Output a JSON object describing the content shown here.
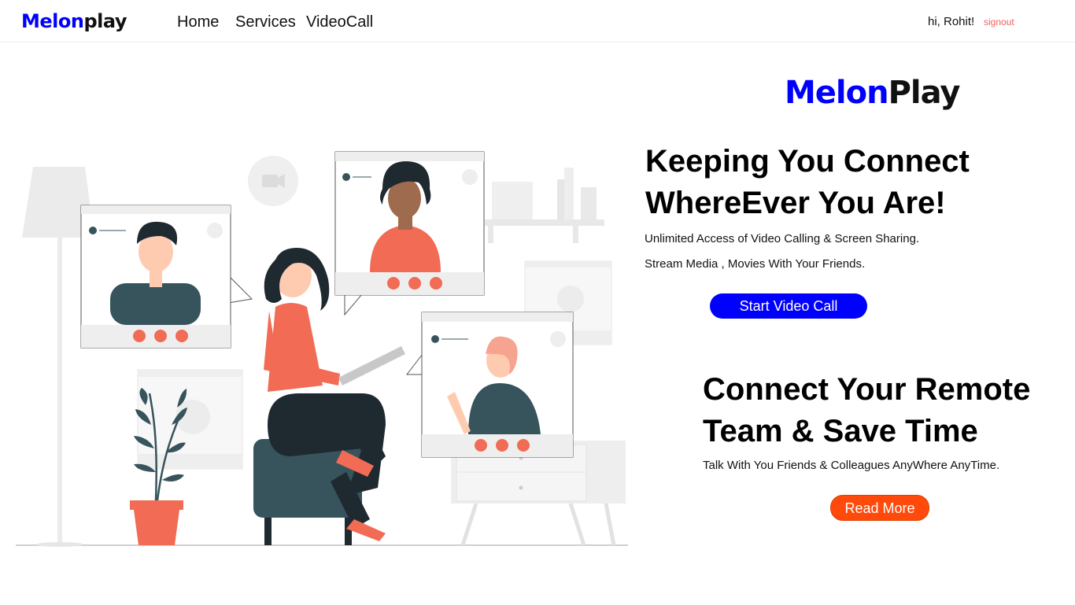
{
  "navbar": {
    "brand_part1": "Melon",
    "brand_part2": "play",
    "links": [
      "Home",
      "Services",
      "VideoCall"
    ],
    "greeting": "hi, Rohit!",
    "signout": "signout"
  },
  "hero": {
    "logo_part1": "Melon",
    "logo_part2": "Play",
    "headline1_line1": "Keeping You Connect",
    "headline1_line2": "WhereEver You Are!",
    "desc1": "Unlimited Access of Video Calling & Screen Sharing.",
    "desc2": "Stream Media , Movies With Your Friends.",
    "button1": "Start Video Call",
    "headline2_line1": "Connect Your Remote",
    "headline2_line2": "Team & Save Time",
    "desc3": "Talk With You Friends & Colleagues AnyWhere AnyTime.",
    "button2": "Read More"
  },
  "colors": {
    "brand_blue": "#0000ff",
    "accent_orange": "#ff4a0b",
    "illustration_coral": "#f26b55",
    "illustration_teal": "#37535c"
  }
}
